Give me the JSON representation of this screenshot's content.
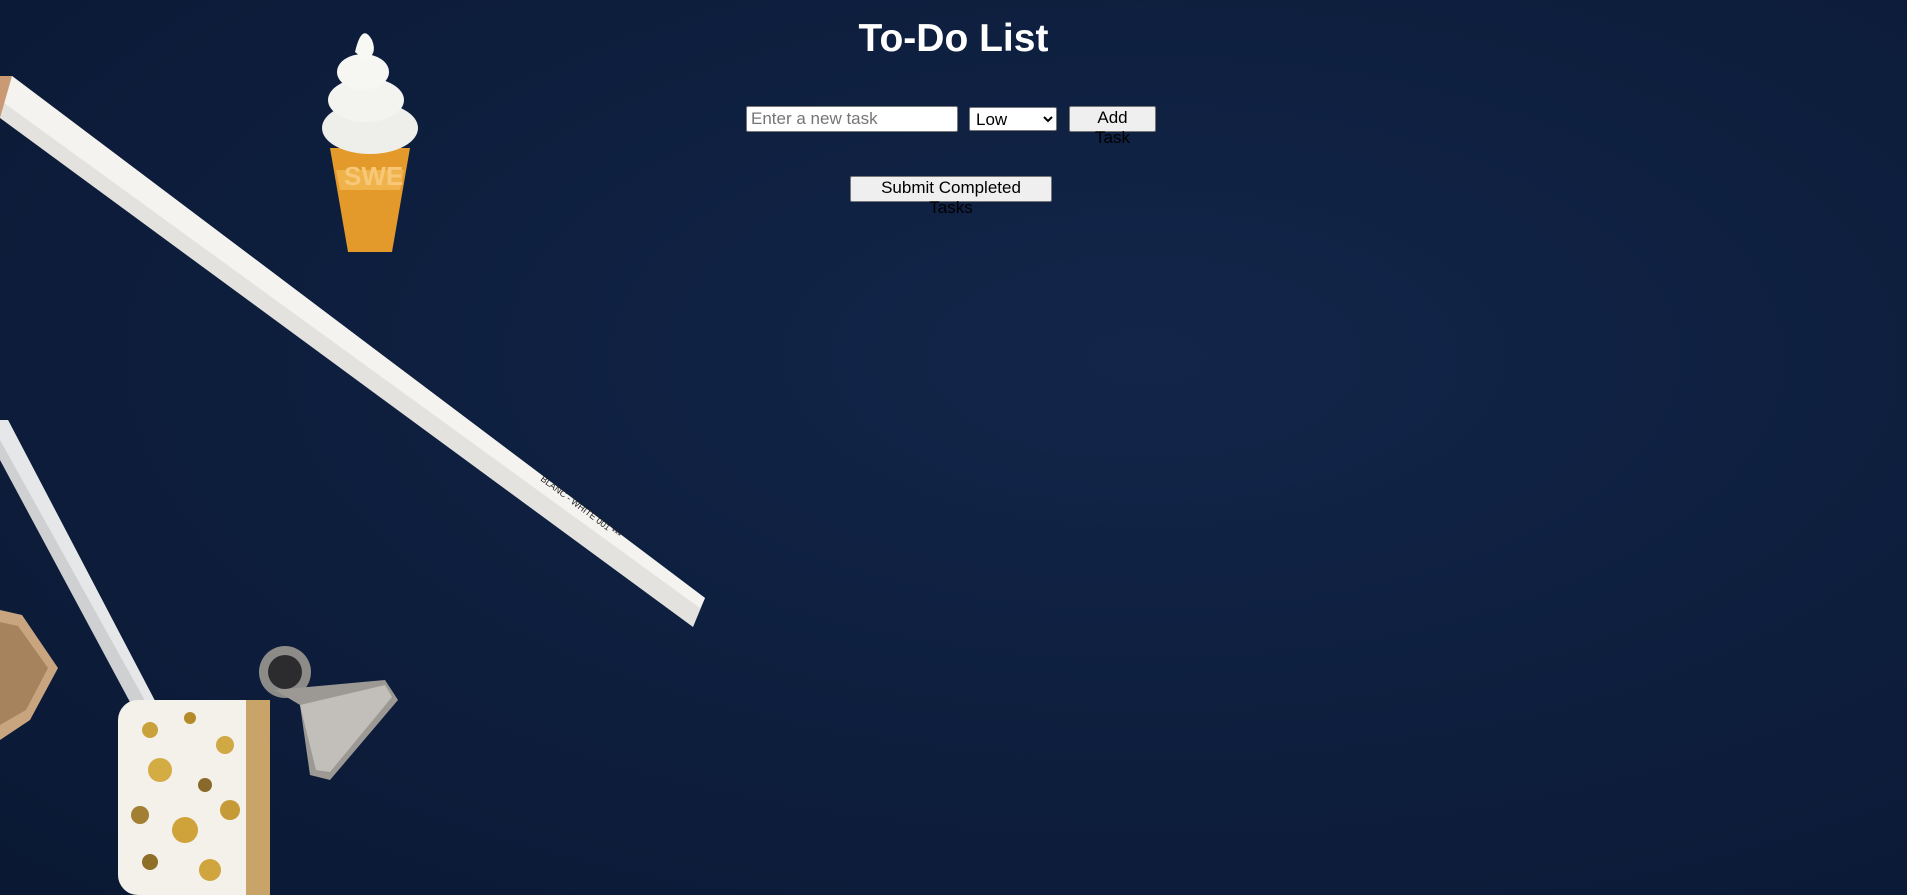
{
  "app": {
    "title": "To-Do List"
  },
  "task_form": {
    "input_placeholder": "Enter a new task",
    "input_value": "",
    "priority_selected": "Low",
    "priority_options": [
      "Low"
    ],
    "add_button_label": "Add Task"
  },
  "actions": {
    "submit_label": "Submit Completed Tasks"
  },
  "background": {
    "base_color": "#0e1f3f",
    "decor_items": [
      "pencil",
      "ice-cream-eraser",
      "binder-clip",
      "washi-tape"
    ]
  }
}
